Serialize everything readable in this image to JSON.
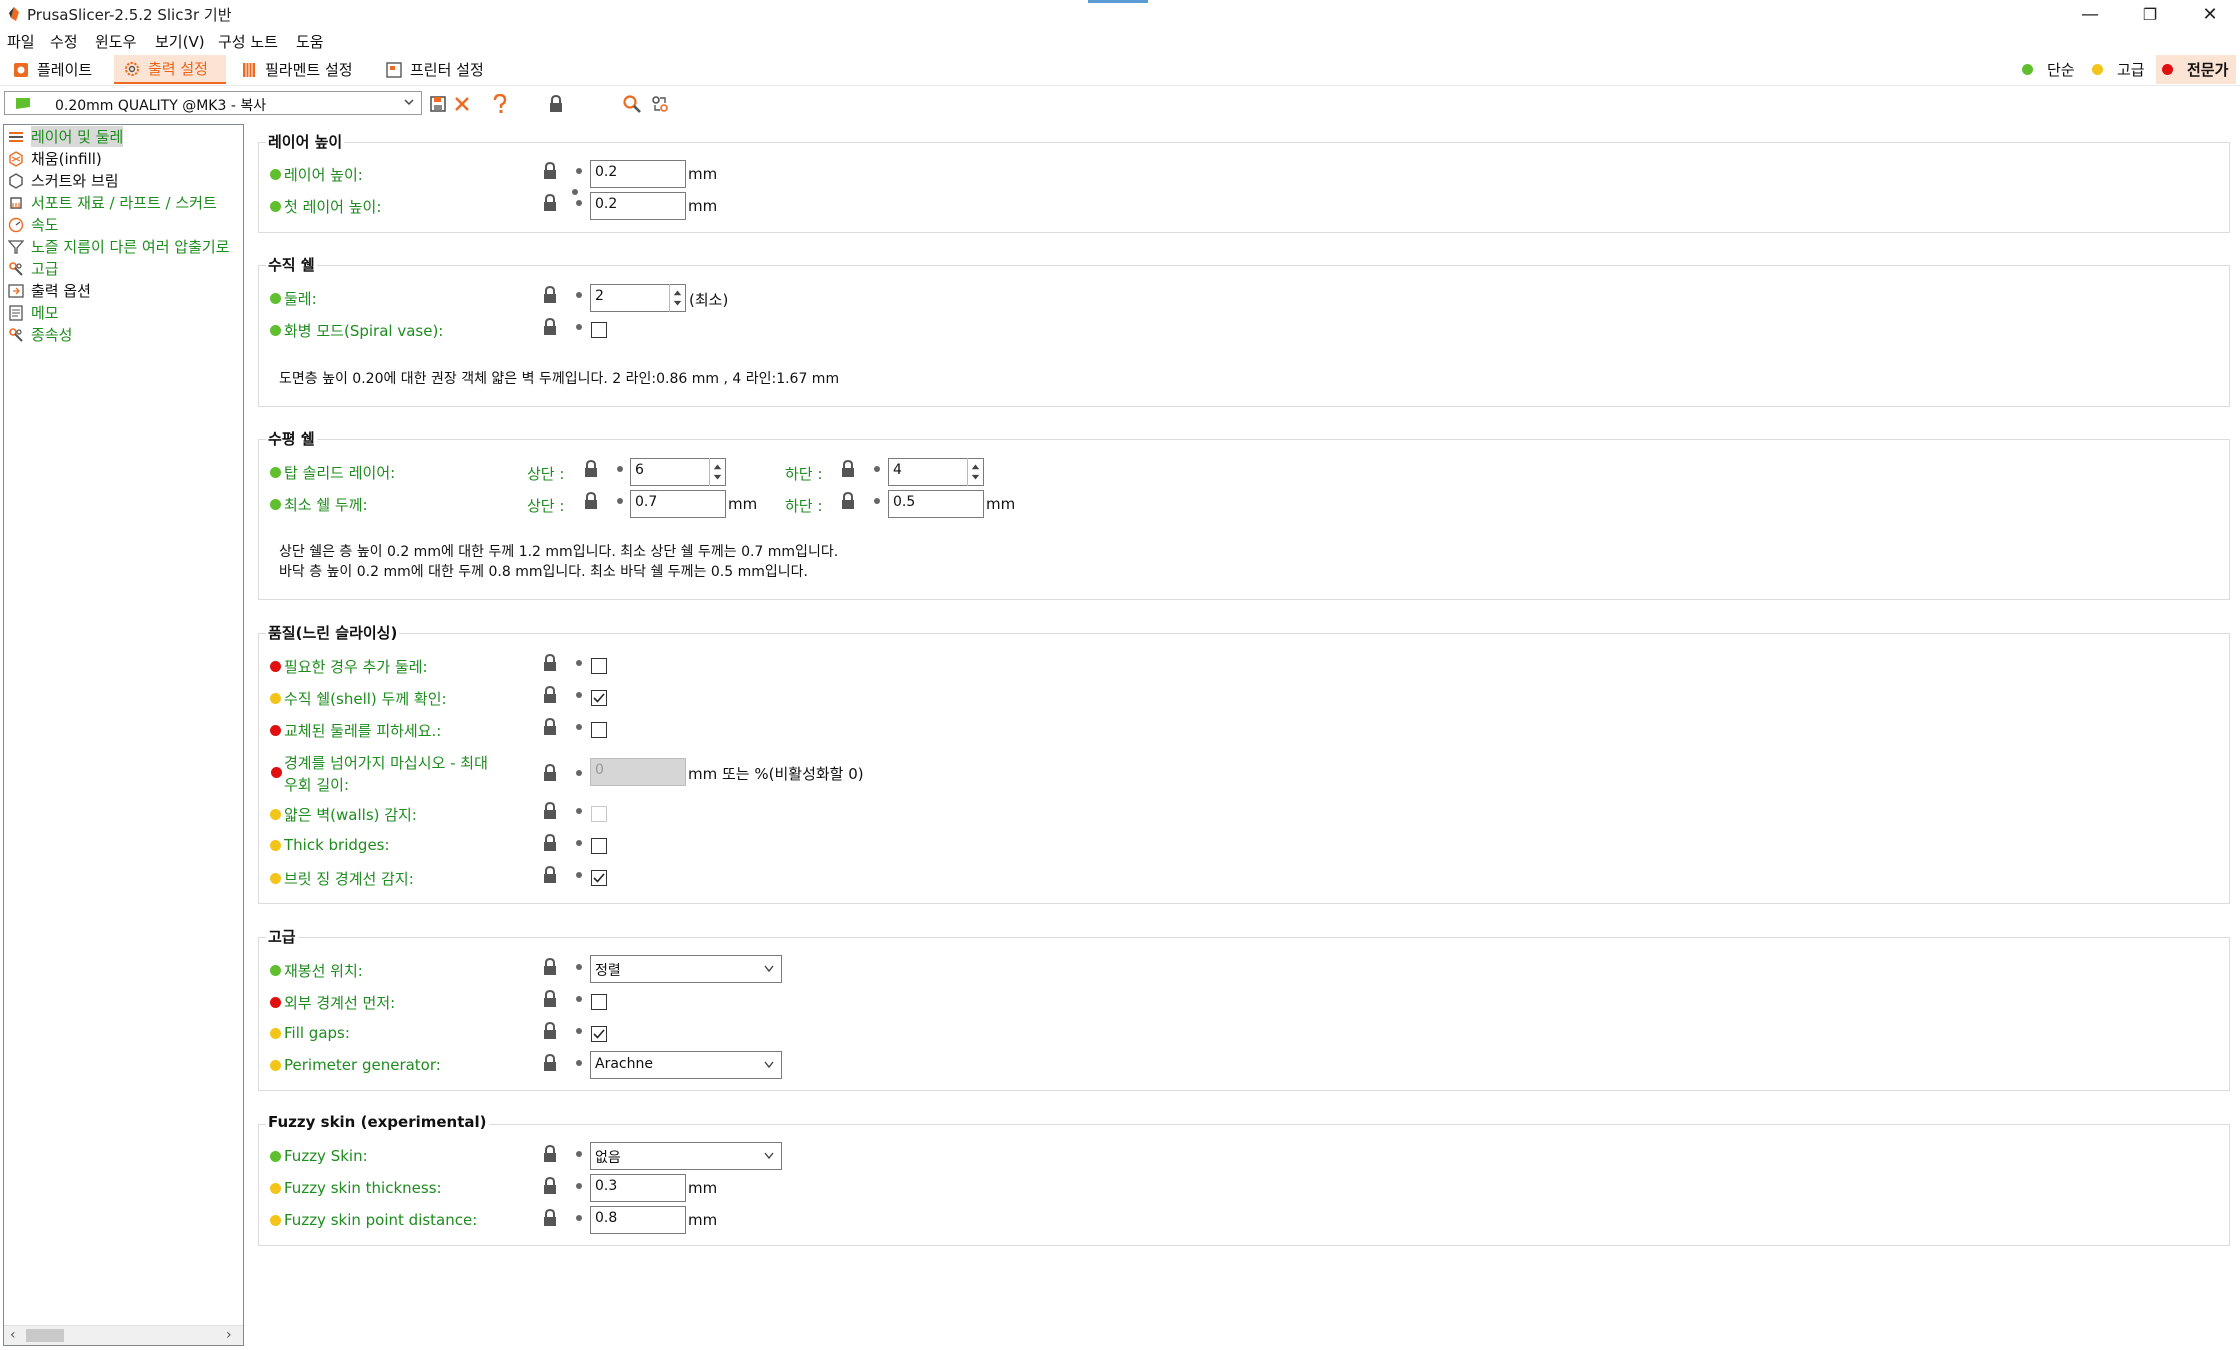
{
  "window": {
    "title": "PrusaSlicer-2.5.2 Slic3r 기반",
    "minimize": "—",
    "maximize": "❐",
    "close": "✕"
  },
  "menu": [
    "파일",
    "수정",
    "윈도우",
    "보기(V)",
    "구성 노트",
    "도움"
  ],
  "tabs": [
    {
      "label": "플레이트",
      "icon": "plater-icon",
      "active": false
    },
    {
      "label": "출력 설정",
      "icon": "cog-icon",
      "active": true
    },
    {
      "label": "필라멘트 설정",
      "icon": "spool-icon",
      "active": false
    },
    {
      "label": "프린터 설정",
      "icon": "printer-icon",
      "active": false
    }
  ],
  "modes": [
    {
      "label": "단순",
      "color": "#5fbf2f"
    },
    {
      "label": "고급",
      "color": "#f3c41a"
    },
    {
      "label": "전문가",
      "color": "#e01010"
    }
  ],
  "preset": {
    "name": "0.20mm QUALITY @MK3 - 복사"
  },
  "sidebar": {
    "items": [
      {
        "label": "레이어 및 둘레",
        "color": "#1f8c1f",
        "selected": true,
        "icon": "layers-icon"
      },
      {
        "label": "채움(infill)",
        "color": "#111111",
        "selected": false,
        "icon": "infill-icon"
      },
      {
        "label": "스커트와 브림",
        "color": "#111111",
        "selected": false,
        "icon": "skirt-icon"
      },
      {
        "label": "서포트 재료 / 라프트 / 스커트",
        "color": "#1f8c1f",
        "selected": false,
        "icon": "support-icon"
      },
      {
        "label": "속도",
        "color": "#1f8c1f",
        "selected": false,
        "icon": "speed-icon"
      },
      {
        "label": "노즐 지름이 다른 여러 압출기로",
        "color": "#1f8c1f",
        "selected": false,
        "icon": "funnel-icon"
      },
      {
        "label": "고급",
        "color": "#1f8c1f",
        "selected": false,
        "icon": "wrench-icon"
      },
      {
        "label": "출력 옵션",
        "color": "#111111",
        "selected": false,
        "icon": "output-icon"
      },
      {
        "label": "메모",
        "color": "#1f8c1f",
        "selected": false,
        "icon": "note-icon"
      },
      {
        "label": "종속성",
        "color": "#1f8c1f",
        "selected": false,
        "icon": "wrench-icon"
      }
    ]
  },
  "groups": {
    "layer_height": {
      "title": "레이어 높이",
      "layer_height": {
        "label": "레이어 높이:",
        "value": "0.2",
        "unit": "mm"
      },
      "first_layer_height": {
        "label": "첫 레이어 높이:",
        "value": "0.2",
        "unit": "mm"
      }
    },
    "vertical_shells": {
      "title": "수직 쉘",
      "perimeters": {
        "label": "둘레:",
        "value": "2",
        "unit": "(최소)"
      },
      "spiral_vase": {
        "label": "화병 모드(Spiral vase):",
        "checked": false
      },
      "note": "도면층 높이 0.20에 대한 권장 객체 얇은 벽 두께입니다.  2 라인:0.86 mm ,  4 라인:1.67 mm"
    },
    "horizontal_shells": {
      "title": "수평 쉘",
      "solid_layers": {
        "label": "탑 솔리드 레이어:",
        "top_label": "상단 :",
        "top_value": "6",
        "bottom_label": "하단 :",
        "bottom_value": "4"
      },
      "min_shell": {
        "label": "최소 쉘 두께:",
        "top_label": "상단 :",
        "top_value": "0.7",
        "bottom_label": "하단 :",
        "bottom_value": "0.5",
        "unit": "mm"
      },
      "note1": "상단 쉘은 층 높이 0.2 mm에 대한 두께 1.2 mm입니다. 최소 상단 쉘 두께는 0.7 mm입니다.",
      "note2": "바닥 층 높이 0.2 mm에 대한 두께 0.8 mm입니다. 최소 바닥 쉘 두께는 0.5 mm입니다."
    },
    "quality": {
      "title": "품질(느린 슬라이싱)",
      "extra_perimeters": {
        "label": "필요한 경우 추가 둘레:",
        "level": "expert",
        "checked": false
      },
      "ensure_vertical": {
        "label": "수직 쉘(shell) 두께 확인:",
        "level": "advanced",
        "checked": true
      },
      "avoid_crossing": {
        "label": "교체된 둘레를 피하세요.:",
        "level": "expert",
        "checked": false
      },
      "max_detour": {
        "label_line1": "경계를 넘어가지 마십시오 - 최대",
        "label_line2": "우회 길이:",
        "level": "expert",
        "value": "0",
        "unit": "mm 또는 %(비활성화할 0)"
      },
      "thin_walls": {
        "label": "얇은 벽(walls) 감지:",
        "level": "advanced",
        "checked": false
      },
      "thick_bridges": {
        "label": "Thick bridges:",
        "level": "advanced",
        "checked": false
      },
      "bridge_perimeters": {
        "label": "브릿 징 경계선 감지:",
        "level": "advanced",
        "checked": true
      }
    },
    "advanced": {
      "title": "고급",
      "seam_position": {
        "label": "재봉선 위치:",
        "level": "simple",
        "value": "정렬"
      },
      "external_first": {
        "label": "외부 경계선 먼저:",
        "level": "expert",
        "checked": false
      },
      "fill_gaps": {
        "label": "Fill gaps:",
        "level": "advanced",
        "checked": true
      },
      "perimeter_generator": {
        "label": "Perimeter generator:",
        "level": "advanced",
        "value": "Arachne"
      }
    },
    "fuzzy": {
      "title": "Fuzzy skin (experimental)",
      "fuzzy_skin": {
        "label": "Fuzzy Skin:",
        "level": "simple",
        "value": "없음"
      },
      "thickness": {
        "label": "Fuzzy skin thickness:",
        "level": "advanced",
        "value": "0.3",
        "unit": "mm"
      },
      "point_distance": {
        "label": "Fuzzy skin point distance:",
        "level": "advanced",
        "value": "0.8",
        "unit": "mm"
      }
    }
  },
  "colors": {
    "simple": "#5fbf2f",
    "advanced": "#f3c41a",
    "expert": "#e01010",
    "accent": "#ed6b21",
    "label_green": "#1f8c1f"
  }
}
